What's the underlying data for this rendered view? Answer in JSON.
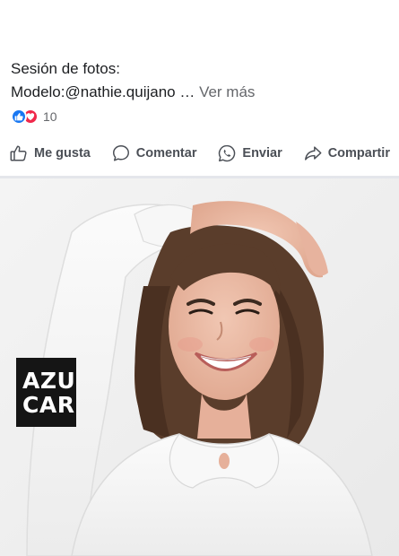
{
  "post": {
    "line1": "Sesión de fotos:",
    "line2_prefix": "Modelo:@nathie.quijano",
    "ellipsis": " … ",
    "see_more": "Ver más"
  },
  "reactions": {
    "types": [
      "like-icon",
      "love-icon"
    ],
    "count": "10",
    "colors": {
      "like": "#1877f2",
      "love": "#f0284a"
    }
  },
  "actions": {
    "like": "Me gusta",
    "comment": "Comentar",
    "send": "Enviar",
    "share": "Compartir"
  },
  "photo": {
    "logo_line1": "AZU",
    "logo_line2": "CAR"
  }
}
